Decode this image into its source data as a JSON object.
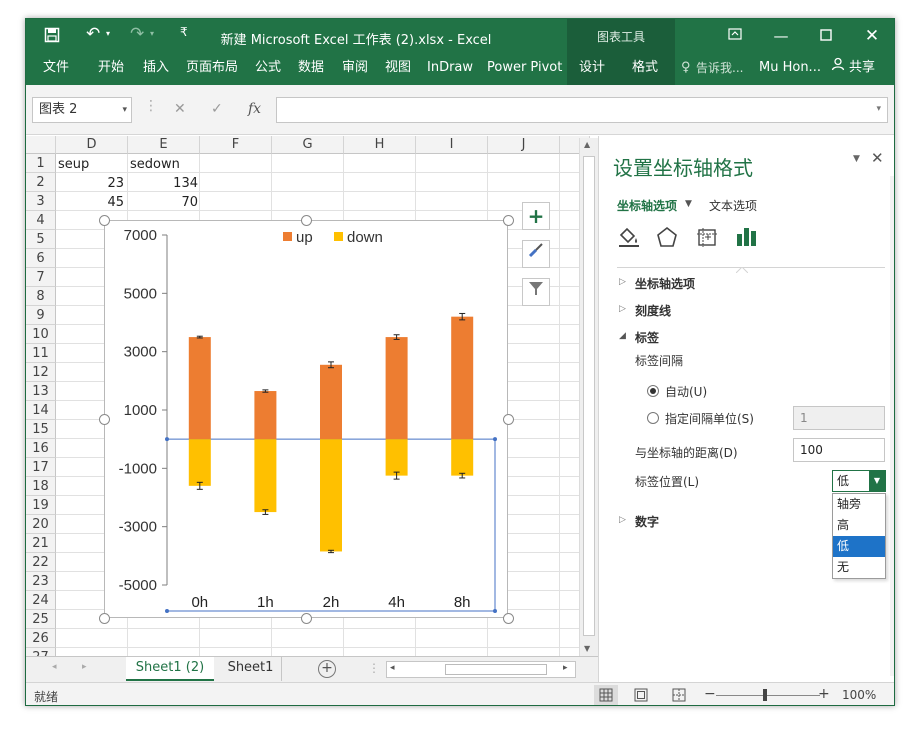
{
  "titlebar": {
    "title": "新建 Microsoft Excel 工作表 (2).xlsx - Excel",
    "context_group": "图表工具",
    "save_icon": "save-icon",
    "undo_icon": "undo-icon",
    "redo_icon": "redo-icon"
  },
  "ribbon": {
    "tabs": [
      "文件",
      "开始",
      "插入",
      "页面布局",
      "公式",
      "数据",
      "审阅",
      "视图",
      "InDraw",
      "Power Pivot",
      "设计",
      "格式"
    ],
    "tell_me": "告诉我...",
    "user": "Mu Hon...",
    "share": "共享"
  },
  "formula_bar": {
    "name_box": "图表 2",
    "fx_label": "fx",
    "formula": ""
  },
  "grid": {
    "columns": [
      "D",
      "E",
      "F",
      "G",
      "H",
      "I",
      "J"
    ],
    "rows": [
      "1",
      "2",
      "3",
      "4",
      "5",
      "6",
      "7",
      "8",
      "9",
      "10",
      "11",
      "12",
      "13",
      "14",
      "15",
      "16",
      "17",
      "18",
      "19",
      "20",
      "21",
      "22",
      "23",
      "24",
      "25",
      "26",
      "27"
    ],
    "cells": {
      "d1": "seup",
      "e1": "sedown",
      "d2": "23",
      "e2": "134",
      "d3": "45",
      "e3": "70",
      "d4": "..."
    }
  },
  "chart_data": {
    "type": "bar",
    "stacked": true,
    "categories": [
      "0h",
      "1h",
      "2h",
      "4h",
      "8h"
    ],
    "series": [
      {
        "name": "up",
        "values": [
          3500,
          1650,
          2550,
          3500,
          4200
        ],
        "errors": [
          30,
          40,
          100,
          80,
          110
        ],
        "color": "#ED7D31"
      },
      {
        "name": "down",
        "values": [
          -1600,
          -2500,
          -3850,
          -1250,
          -1250
        ],
        "errors": [
          120,
          80,
          40,
          120,
          80
        ],
        "color": "#FFC000"
      }
    ],
    "yticks": [
      "7000",
      "5000",
      "3000",
      "1000",
      "-1000",
      "-3000",
      "-5000"
    ],
    "ylim": [
      -5000,
      7000
    ],
    "legend": "top",
    "category_label_position": "low"
  },
  "sheet_tabs": {
    "active": "Sheet1 (2)",
    "other": "Sheet1"
  },
  "status": {
    "ready": "就绪",
    "zoom": "100%"
  },
  "pane": {
    "title": "设置坐标轴格式",
    "tab_axis_options": "坐标轴选项",
    "tab_text_options": "文本选项",
    "sections": {
      "axis_options": "坐标轴选项",
      "tick_marks": "刻度线",
      "labels": "标签",
      "number": "数字"
    },
    "label_interval": "标签间隔",
    "auto": "自动(U)",
    "specify_interval": "指定间隔单位(S)",
    "interval_value": "1",
    "distance_label": "与坐标轴的距离(D)",
    "distance_value": "100",
    "label_position": "标签位置(L)",
    "label_position_value": "低",
    "label_position_options": [
      "轴旁",
      "高",
      "低",
      "无"
    ]
  }
}
